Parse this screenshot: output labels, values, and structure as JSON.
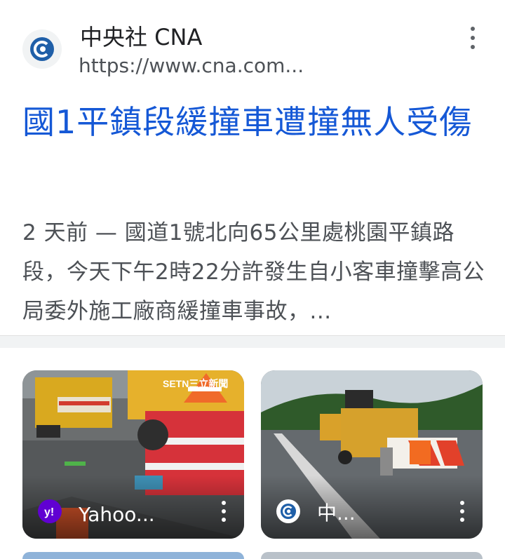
{
  "result": {
    "site_name": "中央社 CNA",
    "site_url": "https://www.cna.com...",
    "favicon_icon": "cna-logo-icon",
    "menu_icon": "more-vert-icon",
    "title": "國1平鎮段緩撞車遭撞無人受傷",
    "snippet": "2 天前 — 國道1號北向65公里處桃園平鎮路段，今天下午2時22分許發生自小客車撞擊高公局委外施工廠商緩撞車事故，..."
  },
  "images": [
    {
      "source_label": "Yahoo...",
      "source_icon": "yahoo-logo-icon",
      "source_color": "#6001d2",
      "watermark": "SETN三立新聞"
    },
    {
      "source_label": "中...",
      "source_icon": "cna-logo-icon",
      "source_color": "#ffffff"
    }
  ],
  "colors": {
    "link": "#1558d6",
    "text": "#202124",
    "muted": "#4d5156",
    "divider": "#f1f3f4"
  }
}
